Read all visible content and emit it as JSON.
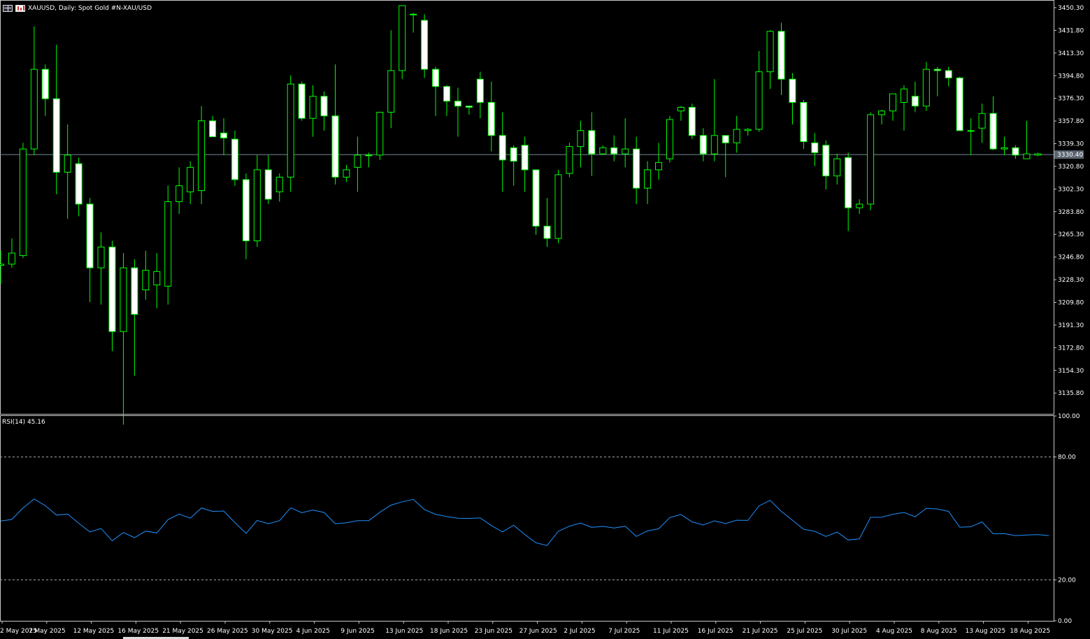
{
  "header": {
    "symbol_line": "XAUUSD, Daily:  Spot Gold #N-XAU/USD",
    "icon_left": "grid-icon",
    "icon_right": "bars-icon"
  },
  "rsi": {
    "label": "RSI(14) 45.16",
    "levels": [
      "100.00",
      "80.00",
      "20.00",
      "0.00"
    ]
  },
  "colors": {
    "background": "#000000",
    "bull_stroke": "#00ff00",
    "bear_fill": "#ffffff",
    "rsi_line": "#1e90ff",
    "current_price_line": "#778899"
  },
  "chart_data": [
    {
      "type": "candlestick",
      "symbol": "XAUUSD",
      "timeframe": "Daily",
      "current_price": 3330.4,
      "current_price_label": "3330.40",
      "ylim": [
        3118.8,
        3456.0
      ],
      "y_ticks": [
        "3450.30",
        "3431.80",
        "3413.30",
        "3394.80",
        "3376.30",
        "3357.80",
        "3339.30",
        "3320.80",
        "3302.30",
        "3283.80",
        "3265.30",
        "3246.80",
        "3228.30",
        "3209.80",
        "3191.30",
        "3172.80",
        "3154.30",
        "3135.80"
      ],
      "x_labels": [
        "2 May 2025",
        "7 May 2025",
        "12 May 2025",
        "16 May 2025",
        "21 May 2025",
        "26 May 2025",
        "30 May 2025",
        "4 Jun 2025",
        "9 Jun 2025",
        "13 Jun 2025",
        "18 Jun 2025",
        "23 Jun 2025",
        "27 Jun 2025",
        "2 Jul 2025",
        "7 Jul 2025",
        "11 Jul 2025",
        "16 Jul 2025",
        "21 Jul 2025",
        "25 Jul 2025",
        "30 Jul 2025",
        "4 Aug 2025",
        "8 Aug 2025",
        "13 Aug 2025",
        "18 Aug 2025"
      ],
      "ohlc": [
        [
          3240,
          3252,
          3225,
          3241
        ],
        [
          3241,
          3262,
          3238,
          3250
        ],
        [
          3248,
          3340,
          3246,
          3335
        ],
        [
          3335,
          3435,
          3330,
          3400
        ],
        [
          3400,
          3404,
          3362,
          3376
        ],
        [
          3376,
          3420,
          3298,
          3316
        ],
        [
          3316,
          3355,
          3278,
          3330
        ],
        [
          3323,
          3328,
          3280,
          3290
        ],
        [
          3290,
          3295,
          3210,
          3238
        ],
        [
          3238,
          3267,
          3208,
          3255
        ],
        [
          3255,
          3260,
          3170,
          3186
        ],
        [
          3186,
          3250,
          3110,
          3238
        ],
        [
          3238,
          3245,
          3150,
          3200
        ],
        [
          3220,
          3252,
          3212,
          3236
        ],
        [
          3224,
          3250,
          3205,
          3235
        ],
        [
          3223,
          3305,
          3208,
          3292
        ],
        [
          3292,
          3320,
          3282,
          3305
        ],
        [
          3300,
          3325,
          3290,
          3320
        ],
        [
          3301,
          3370,
          3290,
          3358
        ],
        [
          3358,
          3362,
          3345,
          3345
        ],
        [
          3348,
          3360,
          3330,
          3344
        ],
        [
          3343,
          3350,
          3305,
          3310
        ],
        [
          3310,
          3315,
          3245,
          3260
        ],
        [
          3260,
          3330,
          3255,
          3318
        ],
        [
          3318,
          3330,
          3290,
          3294
        ],
        [
          3300,
          3315,
          3292,
          3312
        ],
        [
          3312,
          3395,
          3300,
          3388
        ],
        [
          3388,
          3390,
          3358,
          3360
        ],
        [
          3360,
          3387,
          3345,
          3378
        ],
        [
          3378,
          3382,
          3350,
          3362
        ],
        [
          3362,
          3404,
          3306,
          3312
        ],
        [
          3312,
          3322,
          3308,
          3318
        ],
        [
          3320,
          3345,
          3300,
          3330
        ],
        [
          3330,
          3332,
          3320,
          3330
        ],
        [
          3330,
          3365,
          3326,
          3365
        ],
        [
          3365,
          3432,
          3352,
          3399
        ],
        [
          3399,
          3452,
          3392,
          3452
        ],
        [
          3445,
          3446,
          3430,
          3445
        ],
        [
          3440,
          3445,
          3393,
          3400
        ],
        [
          3400,
          3402,
          3362,
          3386
        ],
        [
          3386,
          3387,
          3362,
          3374
        ],
        [
          3374,
          3385,
          3345,
          3370
        ],
        [
          3370,
          3370,
          3363,
          3369
        ],
        [
          3392,
          3398,
          3360,
          3373
        ],
        [
          3373,
          3390,
          3333,
          3346
        ],
        [
          3346,
          3365,
          3300,
          3326
        ],
        [
          3336,
          3338,
          3305,
          3325
        ],
        [
          3338,
          3345,
          3300,
          3318
        ],
        [
          3318,
          3318,
          3265,
          3272
        ],
        [
          3272,
          3295,
          3255,
          3262
        ],
        [
          3262,
          3318,
          3258,
          3314
        ],
        [
          3315,
          3340,
          3312,
          3337
        ],
        [
          3337,
          3358,
          3320,
          3350
        ],
        [
          3350,
          3365,
          3313,
          3331
        ],
        [
          3331,
          3338,
          3330,
          3336
        ],
        [
          3336,
          3346,
          3325,
          3331
        ],
        [
          3331,
          3360,
          3320,
          3335
        ],
        [
          3335,
          3345,
          3290,
          3303
        ],
        [
          3303,
          3325,
          3290,
          3318
        ],
        [
          3318,
          3340,
          3310,
          3324
        ],
        [
          3327,
          3362,
          3324,
          3359
        ],
        [
          3366,
          3370,
          3358,
          3369
        ],
        [
          3369,
          3372,
          3343,
          3346
        ],
        [
          3346,
          3352,
          3325,
          3331
        ],
        [
          3331,
          3392,
          3325,
          3346
        ],
        [
          3346,
          3346,
          3312,
          3340
        ],
        [
          3340,
          3362,
          3332,
          3351
        ],
        [
          3350,
          3352,
          3346,
          3351
        ],
        [
          3351,
          3415,
          3349,
          3398
        ],
        [
          3398,
          3432,
          3384,
          3431
        ],
        [
          3431,
          3438,
          3379,
          3392
        ],
        [
          3392,
          3397,
          3355,
          3373
        ],
        [
          3373,
          3375,
          3335,
          3341
        ],
        [
          3340,
          3348,
          3321,
          3332
        ],
        [
          3338,
          3342,
          3302,
          3313
        ],
        [
          3313,
          3331,
          3306,
          3327
        ],
        [
          3328,
          3332,
          3268,
          3287
        ],
        [
          3287,
          3294,
          3282,
          3290
        ],
        [
          3290,
          3365,
          3285,
          3363
        ],
        [
          3363,
          3367,
          3355,
          3366
        ],
        [
          3366,
          3379,
          3358,
          3380
        ],
        [
          3373,
          3387,
          3350,
          3384
        ],
        [
          3378,
          3390,
          3365,
          3370
        ],
        [
          3370,
          3406,
          3366,
          3400
        ],
        [
          3400,
          3402,
          3378,
          3399
        ],
        [
          3399,
          3402,
          3386,
          3393
        ],
        [
          3393,
          3394,
          3350,
          3350
        ],
        [
          3350,
          3360,
          3330,
          3350
        ],
        [
          3352,
          3372,
          3340,
          3364
        ],
        [
          3364,
          3378,
          3334,
          3335
        ],
        [
          3335,
          3345,
          3330,
          3336
        ],
        [
          3336,
          3338,
          3327,
          3330
        ],
        [
          3327,
          3358,
          3327,
          3331
        ],
        [
          3330,
          3332,
          3329,
          3331
        ]
      ]
    },
    {
      "type": "line",
      "name": "RSI(14)",
      "ylim": [
        0,
        100
      ],
      "levels": [
        80,
        20
      ],
      "values": [
        48.7,
        49.5,
        55.1,
        59.5,
        56.2,
        51.6,
        52.1,
        47.6,
        43.4,
        45.1,
        39.1,
        43.1,
        40.6,
        43.8,
        42.9,
        49.4,
        52.1,
        50.1,
        55.1,
        53.4,
        53.6,
        48.0,
        42.7,
        49.0,
        47.4,
        48.9,
        55.2,
        52.8,
        54.1,
        52.9,
        47.4,
        47.9,
        48.9,
        48.9,
        53.0,
        56.5,
        58.1,
        59.3,
        54.3,
        52.0,
        50.9,
        50.1,
        50.0,
        50.2,
        46.5,
        43.4,
        46.7,
        42.1,
        38.1,
        36.8,
        43.7,
        46.2,
        47.7,
        45.6,
        46.1,
        45.3,
        46.2,
        41.2,
        43.9,
        44.9,
        50.4,
        51.9,
        48.3,
        46.8,
        48.8,
        47.5,
        49.1,
        49.0,
        56.1,
        58.8,
        53.4,
        49.1,
        44.7,
        43.7,
        41.2,
        43.3,
        39.5,
        40.0,
        50.5,
        50.6,
        52.0,
        52.9,
        50.8,
        54.9,
        54.6,
        53.4,
        45.7,
        45.9,
        48.3,
        42.5,
        42.6,
        41.6,
        41.9,
        42.1,
        41.6
      ]
    }
  ]
}
